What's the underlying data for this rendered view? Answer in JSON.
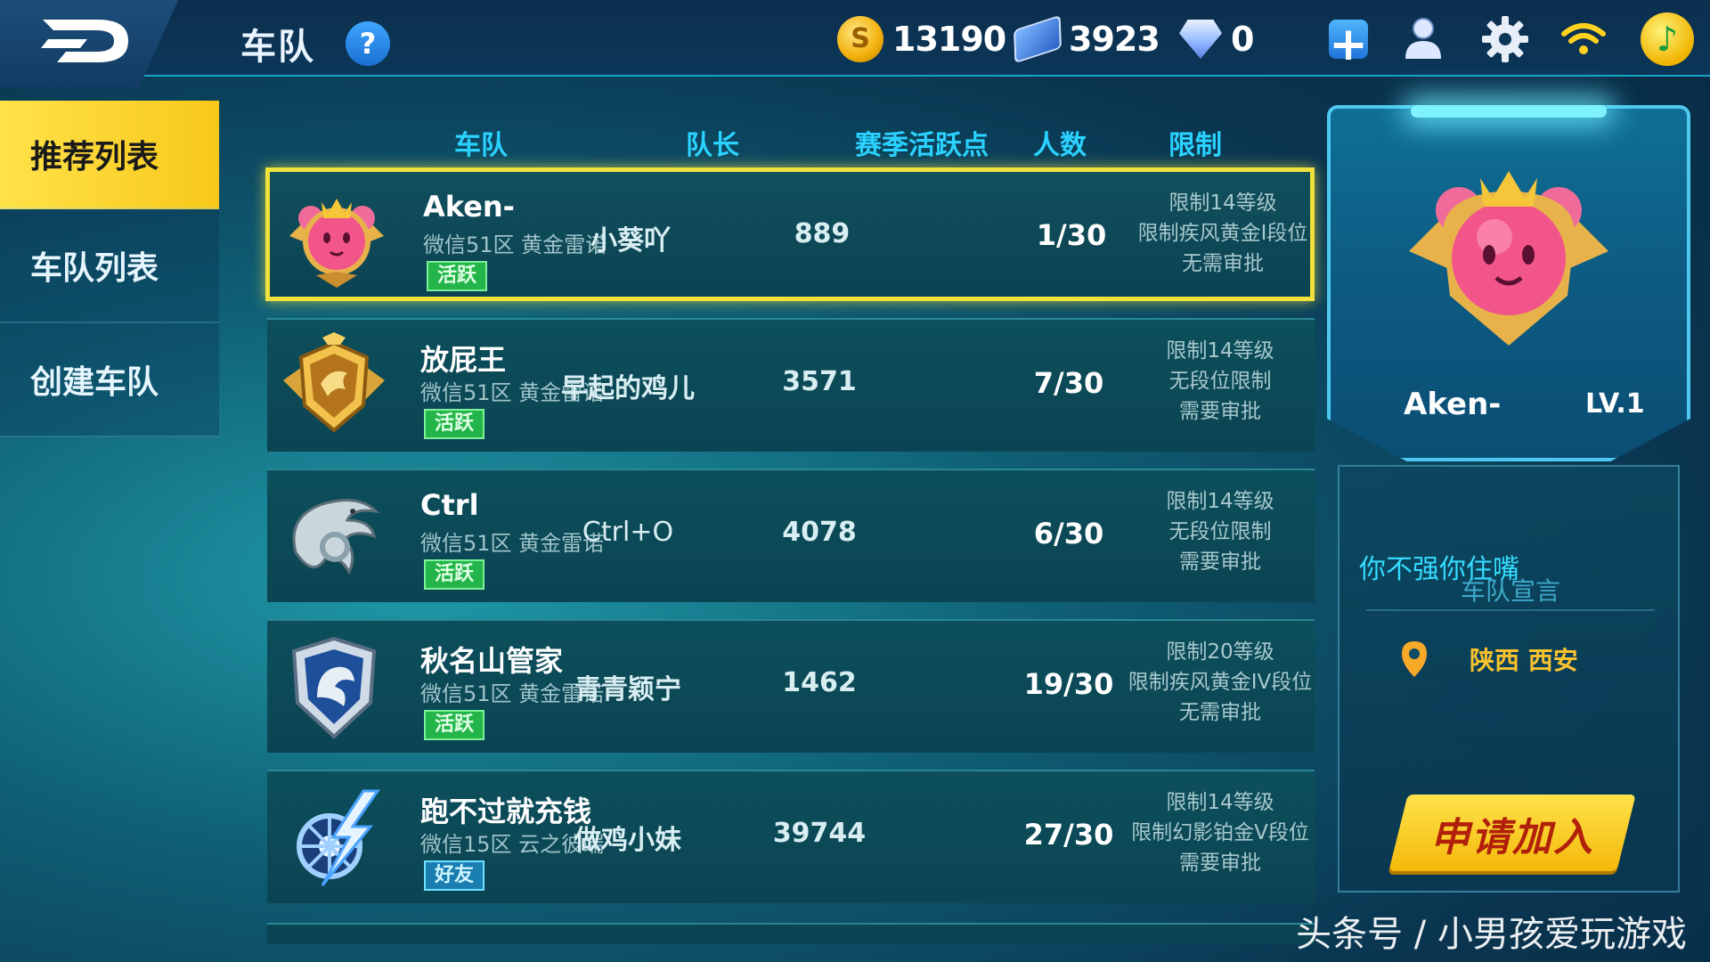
{
  "topbar": {
    "title": "车队",
    "help_label": "?",
    "coins": "13190",
    "tickets": "3923",
    "diamonds": "0",
    "plus_label": "+",
    "music_label": "♪"
  },
  "sidebar": {
    "items": [
      {
        "label": "推荐列表",
        "active": true
      },
      {
        "label": "车队列表",
        "active": false
      },
      {
        "label": "创建车队",
        "active": false
      }
    ]
  },
  "table": {
    "headers": {
      "team": "车队",
      "captain": "队长",
      "points": "赛季活跃点",
      "members": "人数",
      "limit": "限制"
    },
    "rows": [
      {
        "name": "Aken-",
        "server": "微信51区 黄金雷诺",
        "badge": "活跃",
        "captain": "小葵吖",
        "points": "889",
        "members": "1/30",
        "limit1": "限制14等级",
        "limit2": "限制疾风黄金I段位",
        "limit3": "无需审批",
        "emblem": "pink-crown-emblem"
      },
      {
        "name": "放屁王",
        "server": "微信51区 黄金雷诺",
        "badge": "活跃",
        "captain": "早起的鸡儿",
        "points": "3571",
        "members": "7/30",
        "limit1": "限制14等级",
        "limit2": "无段位限制",
        "limit3": "需要审批",
        "emblem": "gold-eagle-emblem"
      },
      {
        "name": "Ctrl",
        "server": "微信51区 黄金雷诺",
        "badge": "活跃",
        "captain": "Ctrl+O",
        "points": "4078",
        "members": "6/30",
        "limit1": "限制14等级",
        "limit2": "无段位限制",
        "limit3": "需要审批",
        "emblem": "silver-dragon-emblem"
      },
      {
        "name": "秋名山管家",
        "server": "微信51区 黄金雷诺",
        "badge": "活跃",
        "captain": "青青颖宁",
        "points": "1462",
        "members": "19/30",
        "limit1": "限制20等级",
        "limit2": "限制疾风黄金IV段位",
        "limit3": "无需审批",
        "emblem": "blue-shield-emblem"
      },
      {
        "name": "跑不过就充钱",
        "server": "微信15区 云之彼端",
        "badge": "好友",
        "captain": "做鸡小妹",
        "points": "39744",
        "members": "27/30",
        "limit1": "限制14等级",
        "limit2": "限制幻影铂金V段位",
        "limit3": "需要审批",
        "emblem": "lightning-wheel-emblem"
      }
    ]
  },
  "panel": {
    "team_name": "Aken-",
    "level": "LV.1",
    "declaration_title": "车队宣言",
    "declaration": "你不强你住嘴",
    "location": "陕西 西安",
    "apply_label": "申请加入"
  },
  "watermark": "头条号 / 小男孩爱玩游戏",
  "colors": {
    "accent_yellow": "#f8c81a",
    "header_cyan": "#2ad2ff",
    "active_green": "#24b54a",
    "friend_blue": "#1a7fb0"
  }
}
